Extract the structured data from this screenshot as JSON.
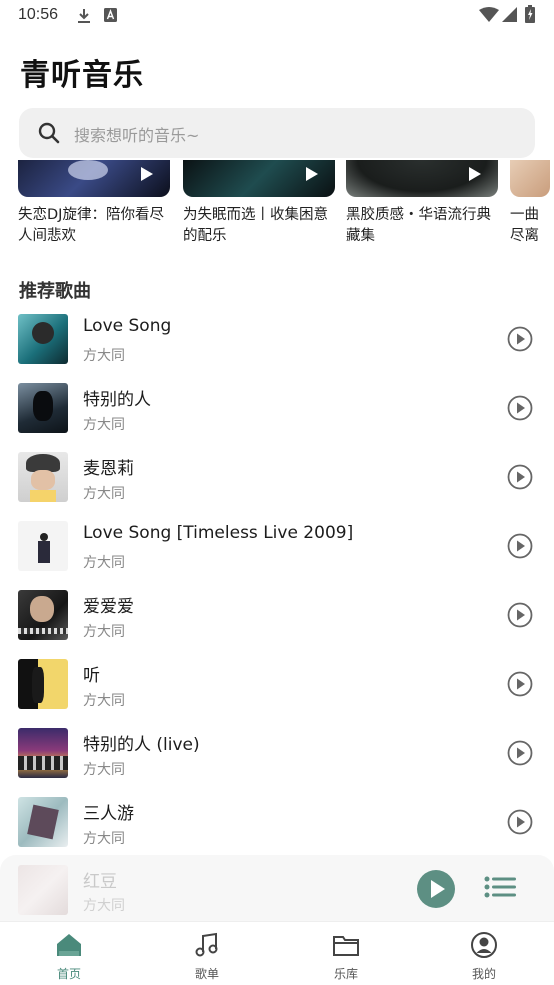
{
  "status_bar": {
    "time": "10:56"
  },
  "app_title": "青听音乐",
  "search": {
    "placeholder": "搜索想听的音乐~"
  },
  "playlists": [
    {
      "title": "失恋DJ旋律：陪你看尽人间悲欢"
    },
    {
      "title": "为失眠而选丨收集困意的配乐"
    },
    {
      "title": "黑胶质感・华语流行典藏集"
    },
    {
      "title": "一曲尽离"
    }
  ],
  "section_title": "推荐歌曲",
  "songs": [
    {
      "title": "Love Song",
      "artist": "方大同"
    },
    {
      "title": "特别的人",
      "artist": "方大同"
    },
    {
      "title": "麦恩莉",
      "artist": "方大同"
    },
    {
      "title": "Love Song [Timeless Live 2009]",
      "artist": "方大同"
    },
    {
      "title": "爱爱爱",
      "artist": "方大同"
    },
    {
      "title": "听",
      "artist": "方大同"
    },
    {
      "title": "特别的人 (live)",
      "artist": "方大同"
    },
    {
      "title": "三人游",
      "artist": "方大同"
    }
  ],
  "player": {
    "title": "红豆",
    "artist": "方大同"
  },
  "tabs": [
    {
      "label": "首页",
      "icon": "home-icon",
      "active": true
    },
    {
      "label": "歌单",
      "icon": "music-note-icon",
      "active": false
    },
    {
      "label": "乐库",
      "icon": "folder-icon",
      "active": false
    },
    {
      "label": "我的",
      "icon": "profile-icon",
      "active": false
    }
  ],
  "colors": {
    "accent": "#4a8a7b",
    "play_circle": "#5d8f83"
  }
}
